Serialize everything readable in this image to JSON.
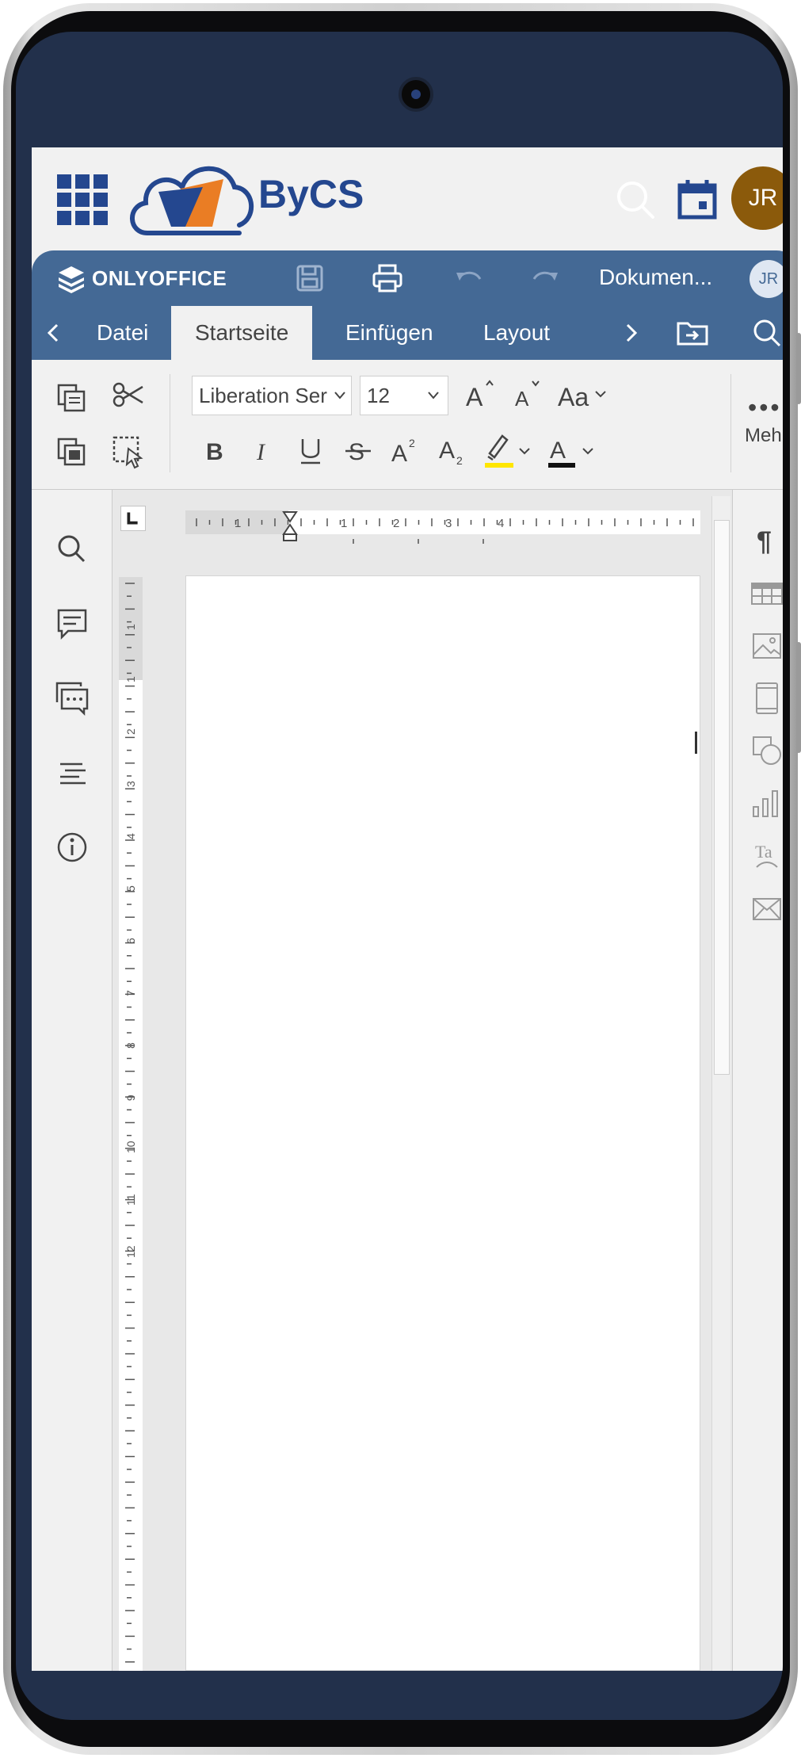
{
  "portal": {
    "brand": "ByCS",
    "avatar_initials": "JR"
  },
  "editor": {
    "app_name": "ONLYOFFICE",
    "document_title": "Dokumen...",
    "avatar_initials": "JR",
    "tabs": [
      {
        "label": "Datei"
      },
      {
        "label": "Startseite"
      },
      {
        "label": "Einfügen"
      },
      {
        "label": "Layout"
      }
    ],
    "font_name": "Liberation Ser",
    "font_size": "12",
    "more_label": "Mehr",
    "ruler": {
      "horizontal_numbers": [
        "1",
        "1",
        "2",
        "3",
        "4"
      ],
      "vertical_numbers": [
        "1",
        "1",
        "2",
        "3",
        "4",
        "5",
        "6",
        "7",
        "8",
        "9",
        "10",
        "11",
        "12"
      ]
    }
  },
  "colors": {
    "accent": "#446995",
    "portal_blue": "#24478f",
    "highlight": "#ffe600",
    "avatar": "#8b5a0b"
  },
  "icons": [
    "apps-grid-icon",
    "bycs-logo-icon",
    "search-icon",
    "calendar-icon",
    "save-icon",
    "print-icon",
    "undo-icon",
    "redo-icon",
    "chevron-left-icon",
    "chevron-right-icon",
    "open-location-icon",
    "copy-icon",
    "cut-icon",
    "paste-icon",
    "select-all-icon",
    "bold-icon",
    "italic-icon",
    "underline-icon",
    "strikethrough-icon",
    "superscript-icon",
    "subscript-icon",
    "highlight-icon",
    "font-color-icon",
    "paragraph-mark-icon",
    "table-icon",
    "image-icon",
    "header-footer-icon",
    "shape-icon",
    "chart-icon",
    "text-art-icon",
    "mail-merge-icon",
    "comments-icon",
    "chat-icon",
    "navigation-icon",
    "info-icon"
  ]
}
